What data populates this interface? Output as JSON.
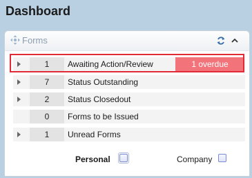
{
  "page": {
    "title": "Dashboard"
  },
  "panel": {
    "title": "Forms",
    "icons": {
      "move": "move-icon",
      "refresh": "refresh-icon",
      "collapse": "chevron-up-icon"
    }
  },
  "rows": [
    {
      "count": "1",
      "label": "Awaiting Action/Review",
      "badge": "1 overdue",
      "expandable": true
    },
    {
      "count": "7",
      "label": "Status Outstanding",
      "expandable": true
    },
    {
      "count": "2",
      "label": "Status Closedout",
      "expandable": true
    },
    {
      "count": "0",
      "label": "Forms to be Issued",
      "expandable": false
    },
    {
      "count": "1",
      "label": "Unread Forms",
      "expandable": true
    }
  ],
  "filters": {
    "personal": {
      "label": "Personal",
      "checked": false
    },
    "company": {
      "label": "Company",
      "checked": false
    }
  },
  "colors": {
    "background": "#b9d0e3",
    "badge": "#f2737a",
    "highlight": "#e02a38"
  }
}
